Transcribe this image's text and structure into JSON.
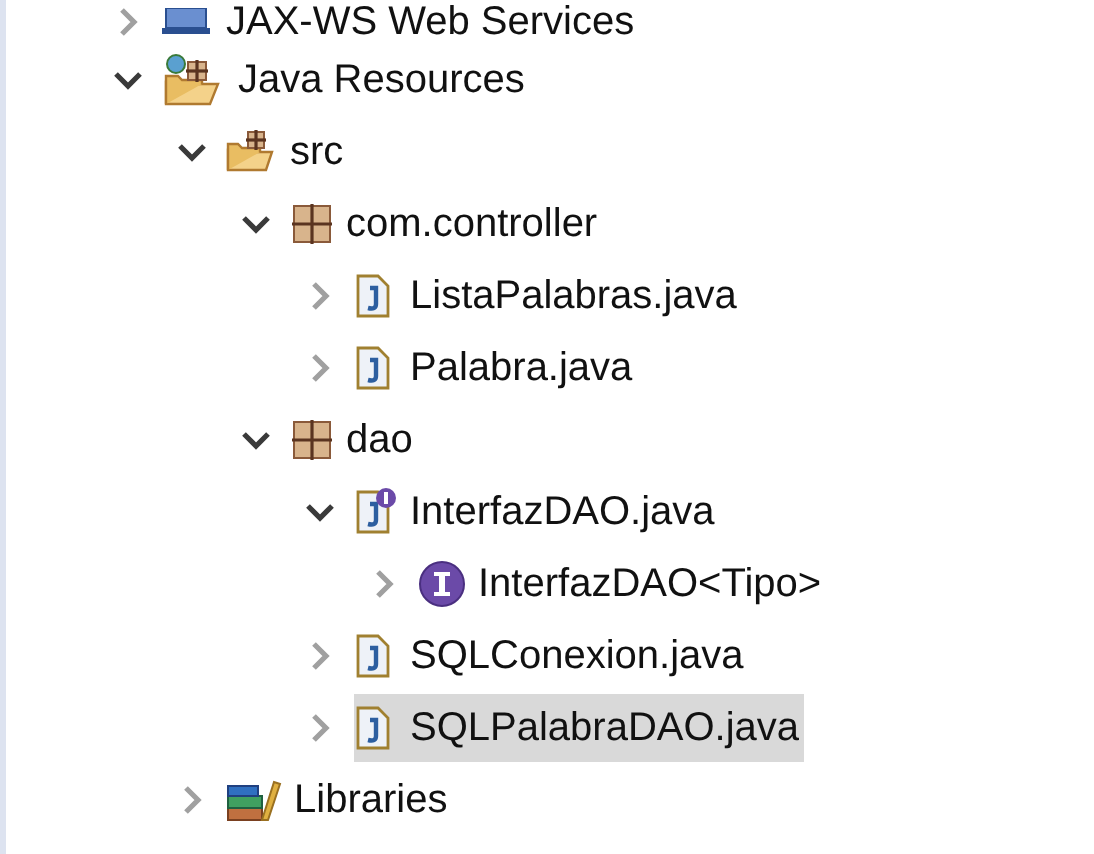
{
  "tree": [
    {
      "label": "JAX-WS Web Services",
      "kind": "webservices",
      "expanded": false,
      "selected": false
    },
    {
      "label": "Java Resources",
      "kind": "java-resources",
      "expanded": true,
      "selected": false,
      "children": [
        {
          "label": "src",
          "kind": "source-folder",
          "expanded": true,
          "selected": false,
          "children": [
            {
              "label": "com.controller",
              "kind": "package",
              "expanded": true,
              "selected": false,
              "children": [
                {
                  "label": "ListaPalabras.java",
                  "kind": "java-file",
                  "expanded": false,
                  "selected": false
                },
                {
                  "label": "Palabra.java",
                  "kind": "java-file",
                  "expanded": false,
                  "selected": false
                }
              ]
            },
            {
              "label": "dao",
              "kind": "package",
              "expanded": true,
              "selected": false,
              "children": [
                {
                  "label": "InterfazDAO.java",
                  "kind": "java-interface-file",
                  "expanded": true,
                  "selected": false,
                  "children": [
                    {
                      "label": "InterfazDAO<Tipo>",
                      "kind": "interface",
                      "expanded": false,
                      "selected": false
                    }
                  ]
                },
                {
                  "label": "SQLConexion.java",
                  "kind": "java-file",
                  "expanded": false,
                  "selected": false
                },
                {
                  "label": "SQLPalabraDAO.java",
                  "kind": "java-file",
                  "expanded": false,
                  "selected": true
                }
              ]
            }
          ]
        },
        {
          "label": "Libraries",
          "kind": "libraries",
          "expanded": false,
          "selected": false
        }
      ]
    }
  ]
}
